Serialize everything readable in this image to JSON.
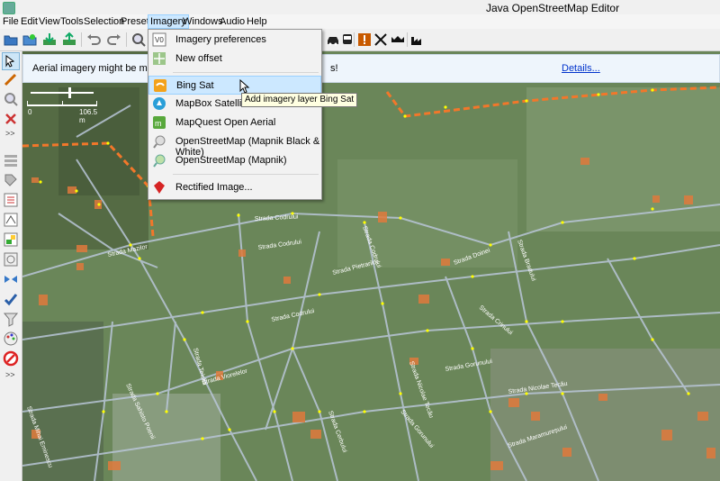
{
  "window": {
    "title": "Java OpenStreetMap Editor"
  },
  "menubar": {
    "items": [
      {
        "label": "File"
      },
      {
        "label": "Edit"
      },
      {
        "label": "View"
      },
      {
        "label": "Tools"
      },
      {
        "label": "Selection"
      },
      {
        "label": "Presets"
      },
      {
        "label": "Imagery"
      },
      {
        "label": "Windows"
      },
      {
        "label": "Audio"
      },
      {
        "label": "Help"
      }
    ],
    "open_menu": "Imagery"
  },
  "notification": {
    "text_start": "Aerial imagery might be misalig",
    "text_end": "s!",
    "details_link": "Details..."
  },
  "scale": {
    "start_label": "0",
    "end_label": "106.5 m"
  },
  "imagery_menu": {
    "items": [
      {
        "label": "Imagery preferences",
        "icon": "imagery-preferences-icon"
      },
      {
        "label": "New offset",
        "icon": "new-offset-icon"
      },
      {
        "label": "Bing Sat",
        "icon": "bing-icon",
        "highlighted": true
      },
      {
        "label": "MapBox Satellite",
        "icon": "mapbox-icon"
      },
      {
        "label": "MapQuest Open Aerial",
        "icon": "mapquest-icon"
      },
      {
        "label": "OpenStreetMap (Mapnik Black & White)",
        "icon": "osm-icon"
      },
      {
        "label": "OpenStreetMap (Mapnik)",
        "icon": "osm-icon"
      },
      {
        "label": "Rectified Image...",
        "icon": "rectified-image-icon"
      }
    ]
  },
  "tooltip": {
    "text": "Add imagery layer Bing Sat"
  },
  "map_labels": [
    "Strada Mazilor",
    "Strada Codrului",
    "Strada Codrului",
    "Strada Codrului",
    "Strada Pietrarilor",
    "Strada Codrului",
    "Strada Doinei",
    "Strada Bradului",
    "Strada Crinului",
    "Strada Teiului",
    "Strada Gorunului",
    "Strada Viorelelor",
    "Strada Sahisto Poenii",
    "Strada Nicolae Tecău",
    "Strada Nicolae Tecău",
    "Strada Gorunului",
    "Strada Maramureșului",
    "Strada Cerbului",
    "Strada Mihai Eminescu"
  ],
  "colors": {
    "map_green": "#5f7a52",
    "road": "#b9c6d8",
    "boundary": "#f2772a",
    "node": "#ffff00",
    "menu_highlight": "#cce8ff"
  }
}
